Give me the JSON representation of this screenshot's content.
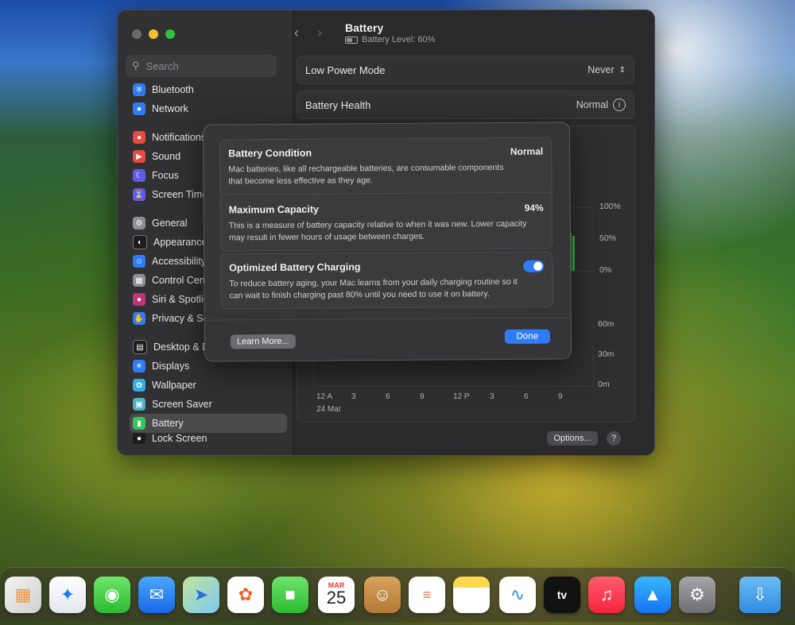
{
  "window": {
    "title": "Battery",
    "subtitle": "Battery Level: 60%",
    "search_placeholder": "Search"
  },
  "sidebar": {
    "items": [
      {
        "label": "Bluetooth",
        "icon": "bluetooth-icon",
        "color": "#2f7df6"
      },
      {
        "label": "Network",
        "icon": "globe-icon",
        "color": "#2f7df6"
      },
      {
        "label": "Notifications",
        "icon": "bell-icon",
        "color": "#e5493f"
      },
      {
        "label": "Sound",
        "icon": "speaker-icon",
        "color": "#e5493f"
      },
      {
        "label": "Focus",
        "icon": "moon-icon",
        "color": "#5e5ce6"
      },
      {
        "label": "Screen Time",
        "icon": "hourglass-icon",
        "color": "#5e5ce6"
      },
      {
        "label": "General",
        "icon": "gear-icon",
        "color": "#8e8e93"
      },
      {
        "label": "Appearance",
        "icon": "appearance-icon",
        "color": "#1c1c1e"
      },
      {
        "label": "Accessibility",
        "icon": "accessibility-icon",
        "color": "#2f7df6"
      },
      {
        "label": "Control Centre",
        "icon": "control-centre-icon",
        "color": "#8e8e93"
      },
      {
        "label": "Siri & Spotlight",
        "icon": "siri-icon",
        "color": "#c0357a"
      },
      {
        "label": "Privacy & Security",
        "icon": "hand-icon",
        "color": "#2f7df6"
      },
      {
        "label": "Desktop & Dock",
        "icon": "desktop-icon",
        "color": "#1c1c1e"
      },
      {
        "label": "Displays",
        "icon": "sun-icon",
        "color": "#2f7df6"
      },
      {
        "label": "Wallpaper",
        "icon": "flower-icon",
        "color": "#32ade6"
      },
      {
        "label": "Screen Saver",
        "icon": "screensaver-icon",
        "color": "#4fb0c6"
      },
      {
        "label": "Battery",
        "icon": "battery-icon",
        "color": "#34c759"
      },
      {
        "label": "Lock Screen",
        "icon": "lock-icon",
        "color": "#1c1c1e"
      }
    ]
  },
  "main": {
    "low_power_label": "Low Power Mode",
    "low_power_value": "Never",
    "health_label": "Battery Health",
    "health_value": "Normal",
    "chart_y_ticks_top": [
      "100%",
      "50%",
      "0%"
    ],
    "chart_y_ticks_bottom": [
      "60m",
      "30m",
      "0m"
    ],
    "chart_x_ticks": [
      "12 A",
      "3",
      "6",
      "9",
      "12 P",
      "3",
      "6",
      "9"
    ],
    "chart_date": "24 Mar",
    "options_label": "Options...",
    "help_label": "?"
  },
  "sheet": {
    "condition_title": "Battery Condition",
    "condition_value": "Normal",
    "condition_desc": "Mac batteries, like all rechargeable batteries, are consumable components that become less effective as they age.",
    "capacity_title": "Maximum Capacity",
    "capacity_value": "94%",
    "capacity_desc": "This is a measure of battery capacity relative to when it was new. Lower capacity may result in fewer hours of usage between charges.",
    "optimized_title": "Optimized Battery Charging",
    "optimized_on": true,
    "optimized_desc": "To reduce battery aging, your Mac learns from your daily charging routine so it can wait to finish charging past 80% until you need to use it on battery.",
    "learn_more_label": "Learn More...",
    "done_label": "Done"
  },
  "dock": {
    "calendar_month": "MAR",
    "calendar_day": "25",
    "tv_label": "tv",
    "items": [
      "launchpad-icon",
      "safari-icon",
      "messages-icon",
      "mail-icon",
      "maps-icon",
      "photos-icon",
      "facetime-icon",
      "calendar-icon",
      "contacts-icon",
      "reminders-icon",
      "notes-icon",
      "freeform-icon",
      "apple-tv-icon",
      "music-icon",
      "app-store-icon",
      "system-settings-icon",
      "downloads-folder-icon"
    ]
  }
}
